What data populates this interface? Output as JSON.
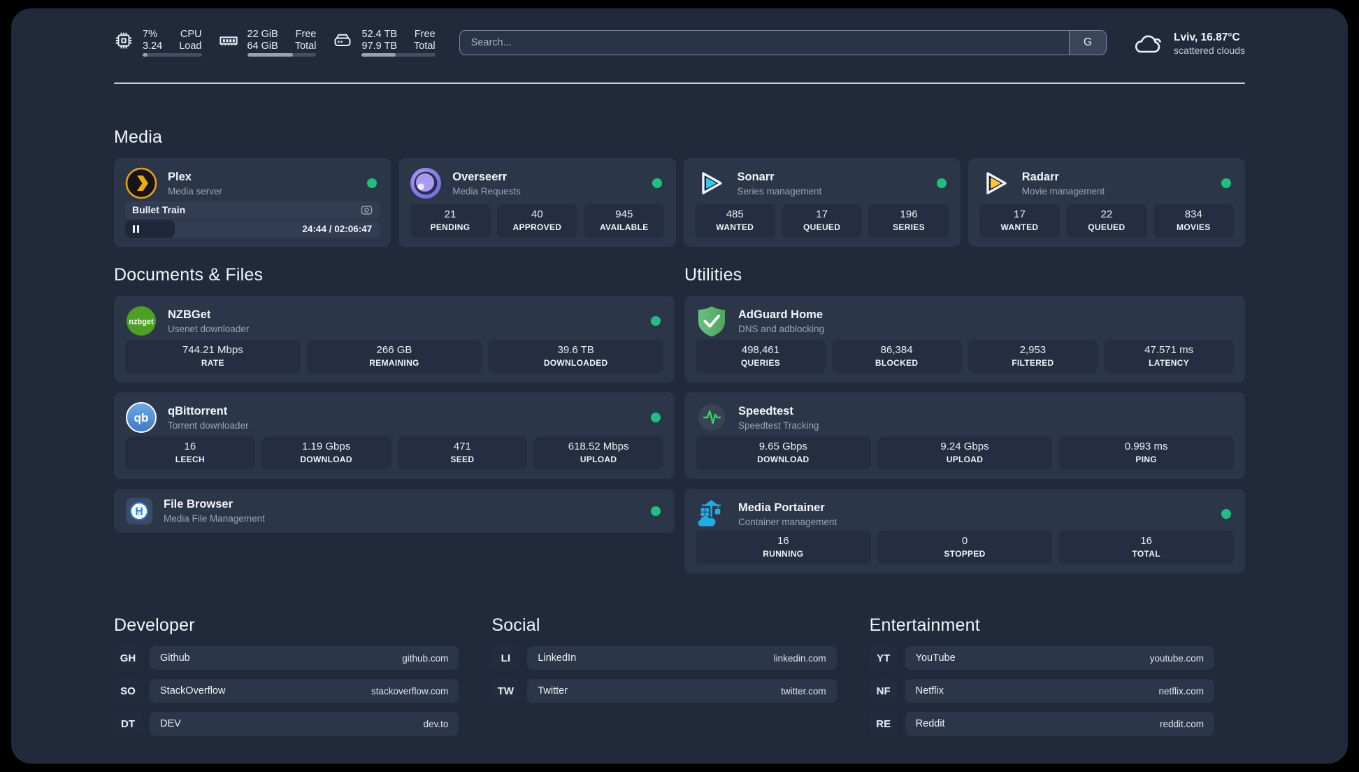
{
  "colors": {
    "background": "#202A3B",
    "card": "#2B3649",
    "tile": "#242E40",
    "status_online": "#1FBF7F",
    "plex_accent": "#E5A00D",
    "sonarr_accent": "#35C5F1",
    "radarr_accent": "#FFC230",
    "adguard_accent": "#5BAF68",
    "portainer_accent": "#1CAEE4",
    "qbittorrent_accent": "#4A8CD2",
    "nzbget_accent": "#4CA023",
    "divider": "#C9CFD9"
  },
  "topbar": {
    "metrics": [
      {
        "name": "cpu",
        "values": [
          "7%",
          "3.24"
        ],
        "labels": [
          "CPU",
          "Load"
        ],
        "progress_pct": 8
      },
      {
        "name": "memory",
        "values": [
          "22 GiB",
          "64 GiB"
        ],
        "labels": [
          "Free",
          "Total"
        ],
        "progress_pct": 66
      },
      {
        "name": "storage",
        "values": [
          "52.4 TB",
          "97.9 TB"
        ],
        "labels": [
          "Free",
          "Total"
        ],
        "progress_pct": 46
      }
    ],
    "search": {
      "placeholder": "Search...",
      "engine_button": "G"
    },
    "weather": {
      "location": "Lviv, 16.87°C",
      "condition": "scattered clouds"
    }
  },
  "sections": {
    "media": {
      "title": "Media",
      "apps": {
        "plex": {
          "title": "Plex",
          "subtitle": "Media server",
          "now_playing": "Bullet Train",
          "time": "24:44 / 02:06:47",
          "progress_pct": 19.5
        },
        "overseerr": {
          "title": "Overseerr",
          "subtitle": "Media Requests",
          "stats": [
            {
              "value": "21",
              "label": "PENDING"
            },
            {
              "value": "40",
              "label": "APPROVED"
            },
            {
              "value": "945",
              "label": "AVAILABLE"
            }
          ]
        },
        "sonarr": {
          "title": "Sonarr",
          "subtitle": "Series management",
          "stats": [
            {
              "value": "485",
              "label": "WANTED"
            },
            {
              "value": "17",
              "label": "QUEUED"
            },
            {
              "value": "196",
              "label": "SERIES"
            }
          ]
        },
        "radarr": {
          "title": "Radarr",
          "subtitle": "Movie management",
          "stats": [
            {
              "value": "17",
              "label": "WANTED"
            },
            {
              "value": "22",
              "label": "QUEUED"
            },
            {
              "value": "834",
              "label": "MOVIES"
            }
          ]
        }
      }
    },
    "documents": {
      "title": "Documents & Files",
      "apps": {
        "nzbget": {
          "title": "NZBGet",
          "subtitle": "Usenet downloader",
          "stats": [
            {
              "value": "744.21 Mbps",
              "label": "RATE"
            },
            {
              "value": "266 GB",
              "label": "REMAINING"
            },
            {
              "value": "39.6 TB",
              "label": "DOWNLOADED"
            }
          ]
        },
        "qbittorrent": {
          "title": "qBittorrent",
          "subtitle": "Torrent downloader",
          "stats": [
            {
              "value": "16",
              "label": "LEECH"
            },
            {
              "value": "1.19 Gbps",
              "label": "DOWNLOAD"
            },
            {
              "value": "471",
              "label": "SEED"
            },
            {
              "value": "618.52 Mbps",
              "label": "UPLOAD"
            }
          ]
        },
        "filebrowser": {
          "title": "File Browser",
          "subtitle": "Media File Management"
        }
      }
    },
    "utilities": {
      "title": "Utilities",
      "apps": {
        "adguard": {
          "title": "AdGuard Home",
          "subtitle": "DNS and adblocking",
          "stats": [
            {
              "value": "498,461",
              "label": "QUERIES"
            },
            {
              "value": "86,384",
              "label": "BLOCKED"
            },
            {
              "value": "2,953",
              "label": "FILTERED"
            },
            {
              "value": "47.571 ms",
              "label": "LATENCY"
            }
          ]
        },
        "speedtest": {
          "title": "Speedtest",
          "subtitle": "Speedtest Tracking",
          "stats": [
            {
              "value": "9.65 Gbps",
              "label": "DOWNLOAD"
            },
            {
              "value": "9.24 Gbps",
              "label": "UPLOAD"
            },
            {
              "value": "0.993 ms",
              "label": "PING"
            }
          ]
        },
        "portainer": {
          "title": "Media Portainer",
          "subtitle": "Container management",
          "stats": [
            {
              "value": "16",
              "label": "RUNNING"
            },
            {
              "value": "0",
              "label": "STOPPED"
            },
            {
              "value": "16",
              "label": "TOTAL"
            }
          ]
        }
      }
    },
    "links": {
      "developer": {
        "title": "Developer",
        "items": [
          {
            "abbr": "GH",
            "name": "Github",
            "url": "github.com"
          },
          {
            "abbr": "SO",
            "name": "StackOverflow",
            "url": "stackoverflow.com"
          },
          {
            "abbr": "DT",
            "name": "DEV",
            "url": "dev.to"
          }
        ]
      },
      "social": {
        "title": "Social",
        "items": [
          {
            "abbr": "LI",
            "name": "LinkedIn",
            "url": "linkedin.com"
          },
          {
            "abbr": "TW",
            "name": "Twitter",
            "url": "twitter.com"
          }
        ]
      },
      "entertainment": {
        "title": "Entertainment",
        "items": [
          {
            "abbr": "YT",
            "name": "YouTube",
            "url": "youtube.com"
          },
          {
            "abbr": "NF",
            "name": "Netflix",
            "url": "netflix.com"
          },
          {
            "abbr": "RE",
            "name": "Reddit",
            "url": "reddit.com"
          }
        ]
      }
    }
  }
}
